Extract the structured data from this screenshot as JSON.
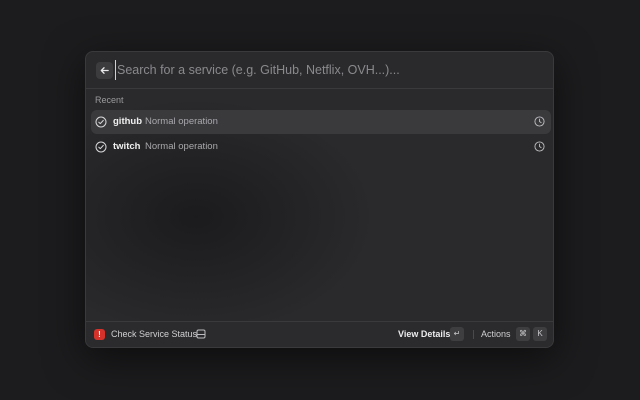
{
  "search": {
    "placeholder": "Search for a service (e.g. GitHub, Netflix, OVH...)..."
  },
  "section": {
    "label": "Recent"
  },
  "items": [
    {
      "name": "github",
      "status": "Normal operation",
      "status_icon": "check-circle-icon",
      "trailing_icon": "clock-icon",
      "selected": true
    },
    {
      "name": "twitch",
      "status": "Normal operation",
      "status_icon": "check-circle-icon",
      "trailing_icon": "clock-icon",
      "selected": false
    }
  ],
  "footer": {
    "title": "Check Service Status",
    "warning_icon": "!",
    "primary_action": "View Details",
    "primary_key": "↵",
    "actions_label": "Actions",
    "actions_keys": [
      "⌘",
      "K"
    ]
  },
  "colors": {
    "background": "#1c1c1e",
    "window": "#2a2a2c",
    "selected_row": "#3a3a3d",
    "warning": "#d5322b"
  }
}
